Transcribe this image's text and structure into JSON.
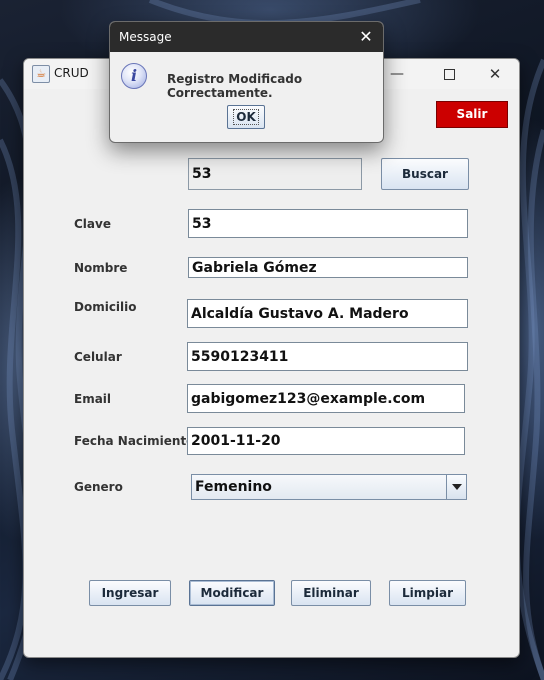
{
  "window": {
    "title": "CRUD",
    "controls": {
      "minimize": "—",
      "close": "✕"
    }
  },
  "header": {
    "exit_label": "Salir",
    "exit_color": "#cc0000"
  },
  "search": {
    "value": "53",
    "button_label": "Buscar"
  },
  "form": {
    "clave": {
      "label": "Clave",
      "value": "53"
    },
    "nombre": {
      "label": "Nombre",
      "value": "Gabriela Gómez"
    },
    "domicilio": {
      "label": "Domicilio",
      "value": "Alcaldía Gustavo A. Madero"
    },
    "celular": {
      "label": "Celular",
      "value": "5590123411"
    },
    "email": {
      "label": "Email",
      "value": "gabigomez123@example.com"
    },
    "fecha": {
      "label": "Fecha Nacimiento",
      "value": "2001-11-20"
    },
    "genero": {
      "label": "Genero",
      "value": "Femenino"
    }
  },
  "actions": {
    "ingresar": "Ingresar",
    "modificar": "Modificar",
    "eliminar": "Eliminar",
    "limpiar": "Limpiar"
  },
  "dialog": {
    "title": "Message",
    "close": "✕",
    "icon": "info-icon",
    "icon_glyph": "i",
    "message": "Registro Modificado Correctamente.",
    "ok_label": "OK"
  }
}
